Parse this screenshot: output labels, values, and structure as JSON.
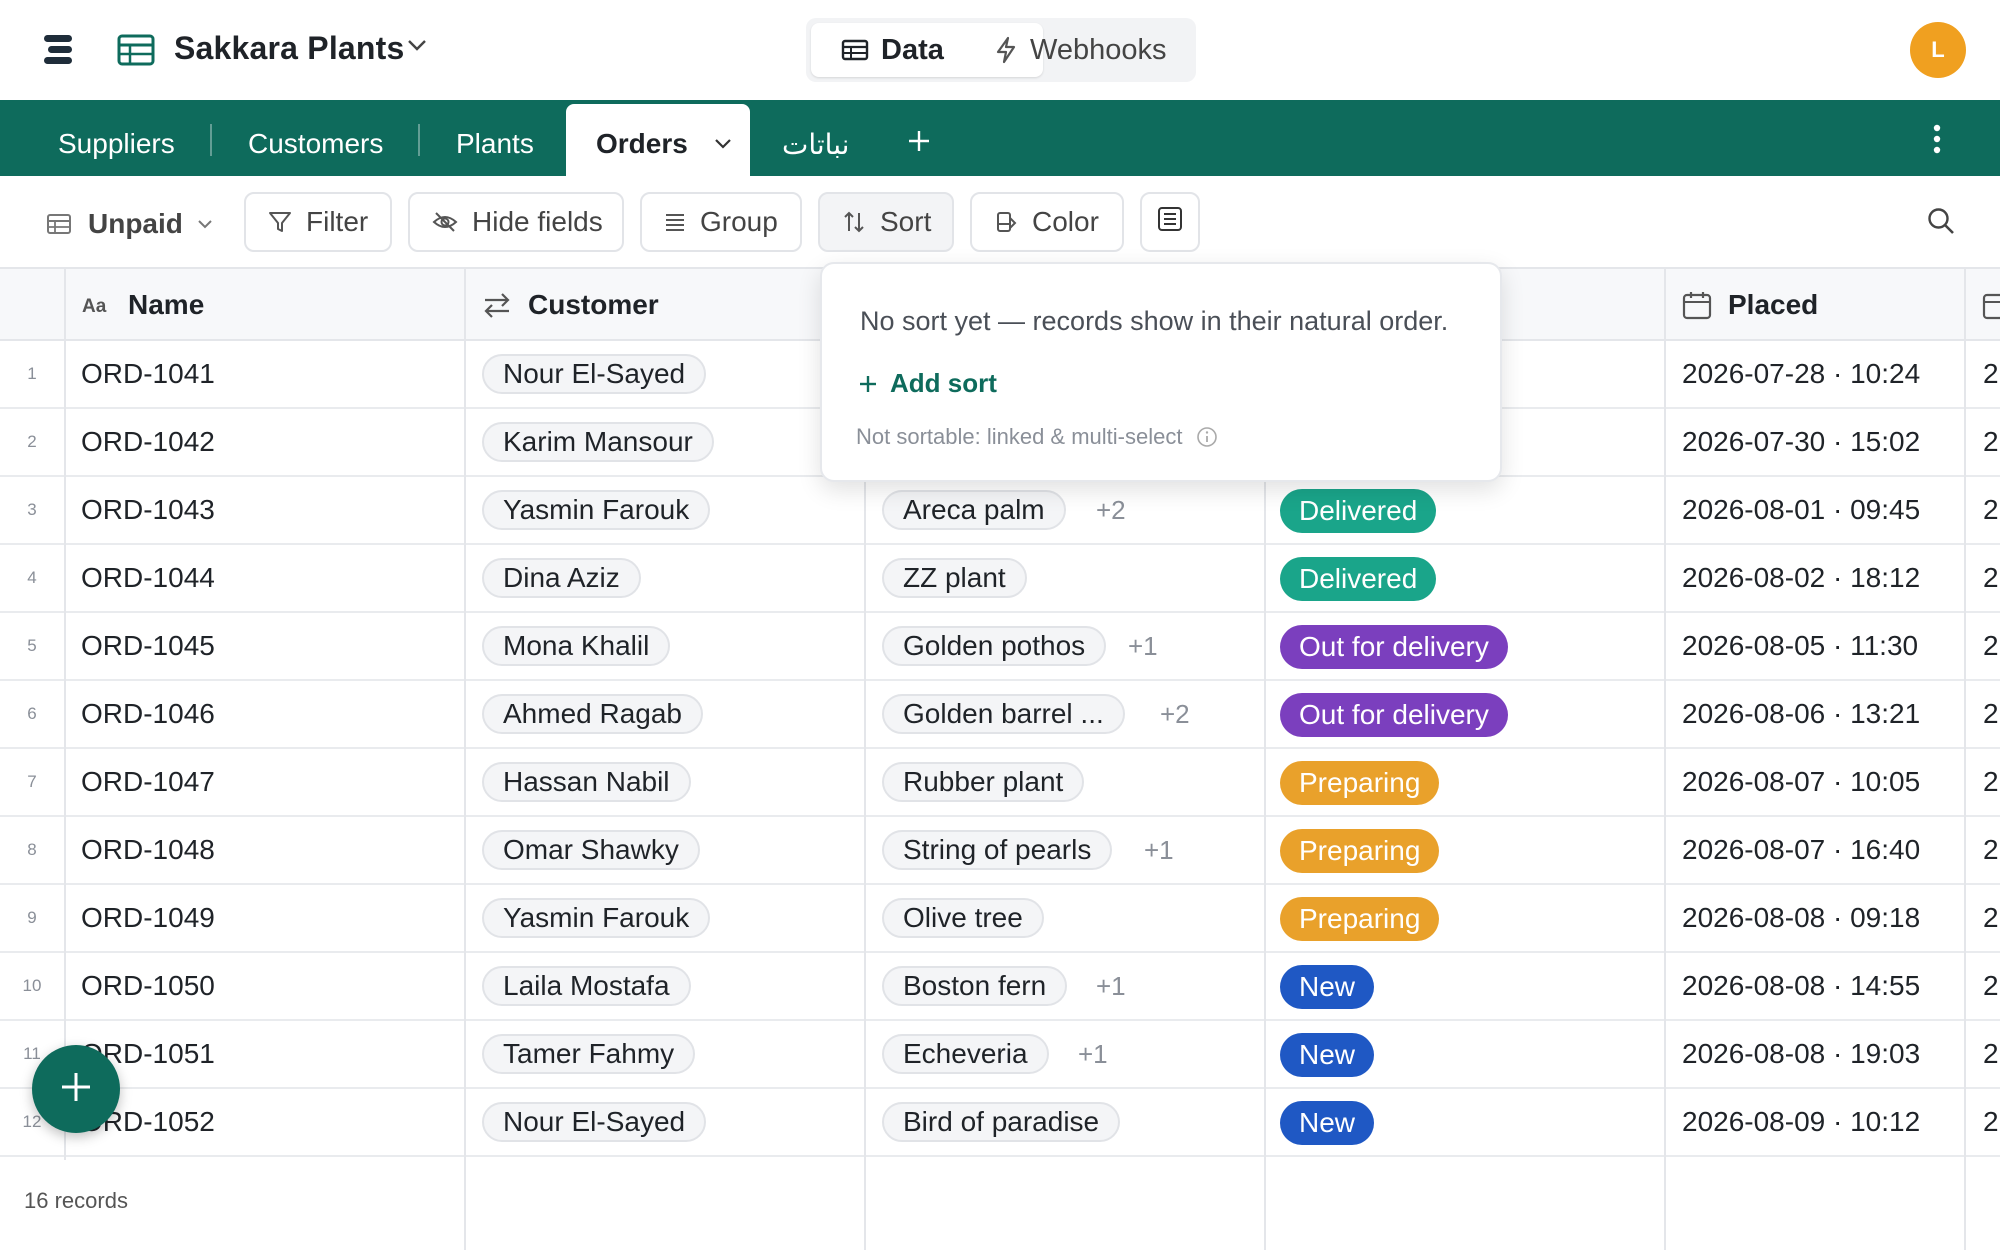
{
  "app": {
    "base_name": "Sakkara Plants",
    "avatar_initial": "L",
    "avatar_color": "#f0a020",
    "brand_color": "#0e6b5c"
  },
  "top_tabs": {
    "data_label": "Data",
    "webhooks_label": "Webhooks"
  },
  "tables": [
    {
      "label": "Suppliers",
      "active": false
    },
    {
      "label": "Customers",
      "active": false
    },
    {
      "label": "Plants",
      "active": false
    },
    {
      "label": "Orders",
      "active": true
    },
    {
      "label": "نباتات",
      "active": false
    }
  ],
  "toolbar": {
    "view_name": "Unpaid",
    "filter": "Filter",
    "hide_fields": "Hide fields",
    "group": "Group",
    "sort": "Sort",
    "color": "Color"
  },
  "columns": {
    "name": "Name",
    "customer": "Customer",
    "placed": "Placed"
  },
  "rows": [
    {
      "n": "1",
      "name": "ORD-1041",
      "customer": "Nour El-Sayed",
      "plant": "",
      "extra": "",
      "status": "",
      "placed": "2026-07-28 · 10:24"
    },
    {
      "n": "2",
      "name": "ORD-1042",
      "customer": "Karim Mansour",
      "plant": "",
      "extra": "",
      "status": "",
      "placed": "2026-07-30 · 15:02"
    },
    {
      "n": "3",
      "name": "ORD-1043",
      "customer": "Yasmin Farouk",
      "plant": "Areca palm",
      "extra": "+2",
      "status": "Delivered",
      "placed": "2026-08-01 · 09:45"
    },
    {
      "n": "4",
      "name": "ORD-1044",
      "customer": "Dina Aziz",
      "plant": "ZZ plant",
      "extra": "",
      "status": "Delivered",
      "placed": "2026-08-02 · 18:12"
    },
    {
      "n": "5",
      "name": "ORD-1045",
      "customer": "Mona Khalil",
      "plant": "Golden pothos",
      "extra": "+1",
      "status": "Out for delivery",
      "placed": "2026-08-05 · 11:30"
    },
    {
      "n": "6",
      "name": "ORD-1046",
      "customer": "Ahmed Ragab",
      "plant": "Golden barrel ...",
      "extra": "+2",
      "status": "Out for delivery",
      "placed": "2026-08-06 · 13:21"
    },
    {
      "n": "7",
      "name": "ORD-1047",
      "customer": "Hassan Nabil",
      "plant": "Rubber plant",
      "extra": "",
      "status": "Preparing",
      "placed": "2026-08-07 · 10:05"
    },
    {
      "n": "8",
      "name": "ORD-1048",
      "customer": "Omar Shawky",
      "plant": "String of pearls",
      "extra": "+1",
      "status": "Preparing",
      "placed": "2026-08-07 · 16:40"
    },
    {
      "n": "9",
      "name": "ORD-1049",
      "customer": "Yasmin Farouk",
      "plant": "Olive tree",
      "extra": "",
      "status": "Preparing",
      "placed": "2026-08-08 · 09:18"
    },
    {
      "n": "10",
      "name": "ORD-1050",
      "customer": "Laila Mostafa",
      "plant": "Boston fern",
      "extra": "+1",
      "status": "New",
      "placed": "2026-08-08 · 14:55"
    },
    {
      "n": "11",
      "name": "ORD-1051",
      "customer": "Tamer Fahmy",
      "plant": "Echeveria",
      "extra": "+1",
      "status": "New",
      "placed": "2026-08-08 · 19:03"
    },
    {
      "n": "12",
      "name": "ORD-1052",
      "customer": "Nour El-Sayed",
      "plant": "Bird of paradise",
      "extra": "",
      "status": "New",
      "placed": "2026-08-09 · 10:12"
    }
  ],
  "status_colors": {
    "Delivered": "#1aa58a",
    "Out for delivery": "#7b3fbe",
    "Preparing": "#e9a12b",
    "New": "#1f58c4"
  },
  "footer": {
    "record_count": "16 records"
  },
  "sort_popover": {
    "message": "No sort yet — records show in their natural order.",
    "add_sort": "Add sort",
    "note": "Not sortable: linked & multi-select"
  }
}
